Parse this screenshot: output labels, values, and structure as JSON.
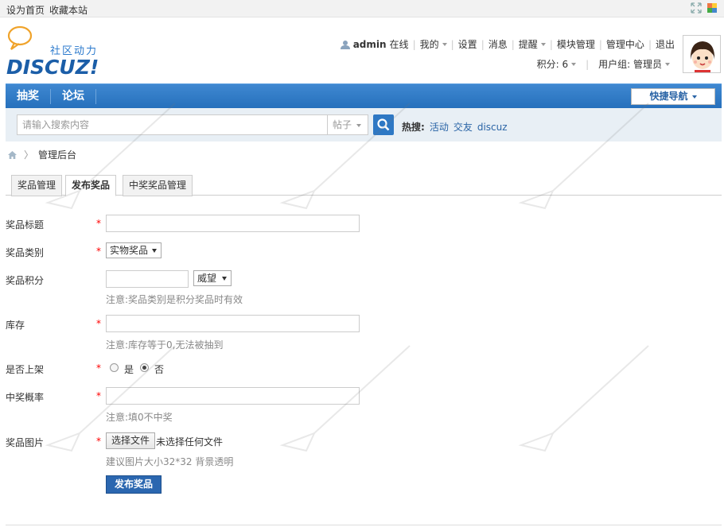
{
  "topbar": {
    "set_home": "设为首页",
    "bookmark": "收藏本站"
  },
  "logo": {
    "slogan": "社区动力",
    "wordmark": "DISCUZ!"
  },
  "user": {
    "username": "admin",
    "online": "在线",
    "mine": "我的",
    "settings": "设置",
    "messages": "消息",
    "reminders": "提醒",
    "module_manage": "模块管理",
    "admin_center": "管理中心",
    "logout": "退出",
    "points_label": "积分: 6",
    "usergroup_label": "用户组: 管理员"
  },
  "nav": {
    "items": [
      "抽奖",
      "论坛"
    ],
    "quick_nav": "快捷导航"
  },
  "search": {
    "placeholder": "请输入搜索内容",
    "type": "帖子",
    "hot_label": "热搜:",
    "hot_keywords": [
      "活动",
      "交友",
      "discuz"
    ]
  },
  "breadcrumb": {
    "current": "管理后台"
  },
  "tabs": [
    "奖品管理",
    "发布奖品",
    "中奖奖品管理"
  ],
  "form": {
    "title_label": "奖品标题",
    "category_label": "奖品类别",
    "category_value": "实物奖品",
    "points_label": "奖品积分",
    "points_unit": "威望",
    "points_hint": "注意:奖品类别是积分奖品时有效",
    "stock_label": "库存",
    "stock_hint": "注意:库存等于0,无法被抽到",
    "onshelf_label": "是否上架",
    "yes": "是",
    "no": "否",
    "probability_label": "中奖概率",
    "probability_hint": "注意:填0不中奖",
    "image_label": "奖品图片",
    "choose_file": "选择文件",
    "no_file": "未选择任何文件",
    "image_hint": "建议图片大小32*32 背景透明",
    "required_mark": "*",
    "submit": "发布奖品"
  }
}
